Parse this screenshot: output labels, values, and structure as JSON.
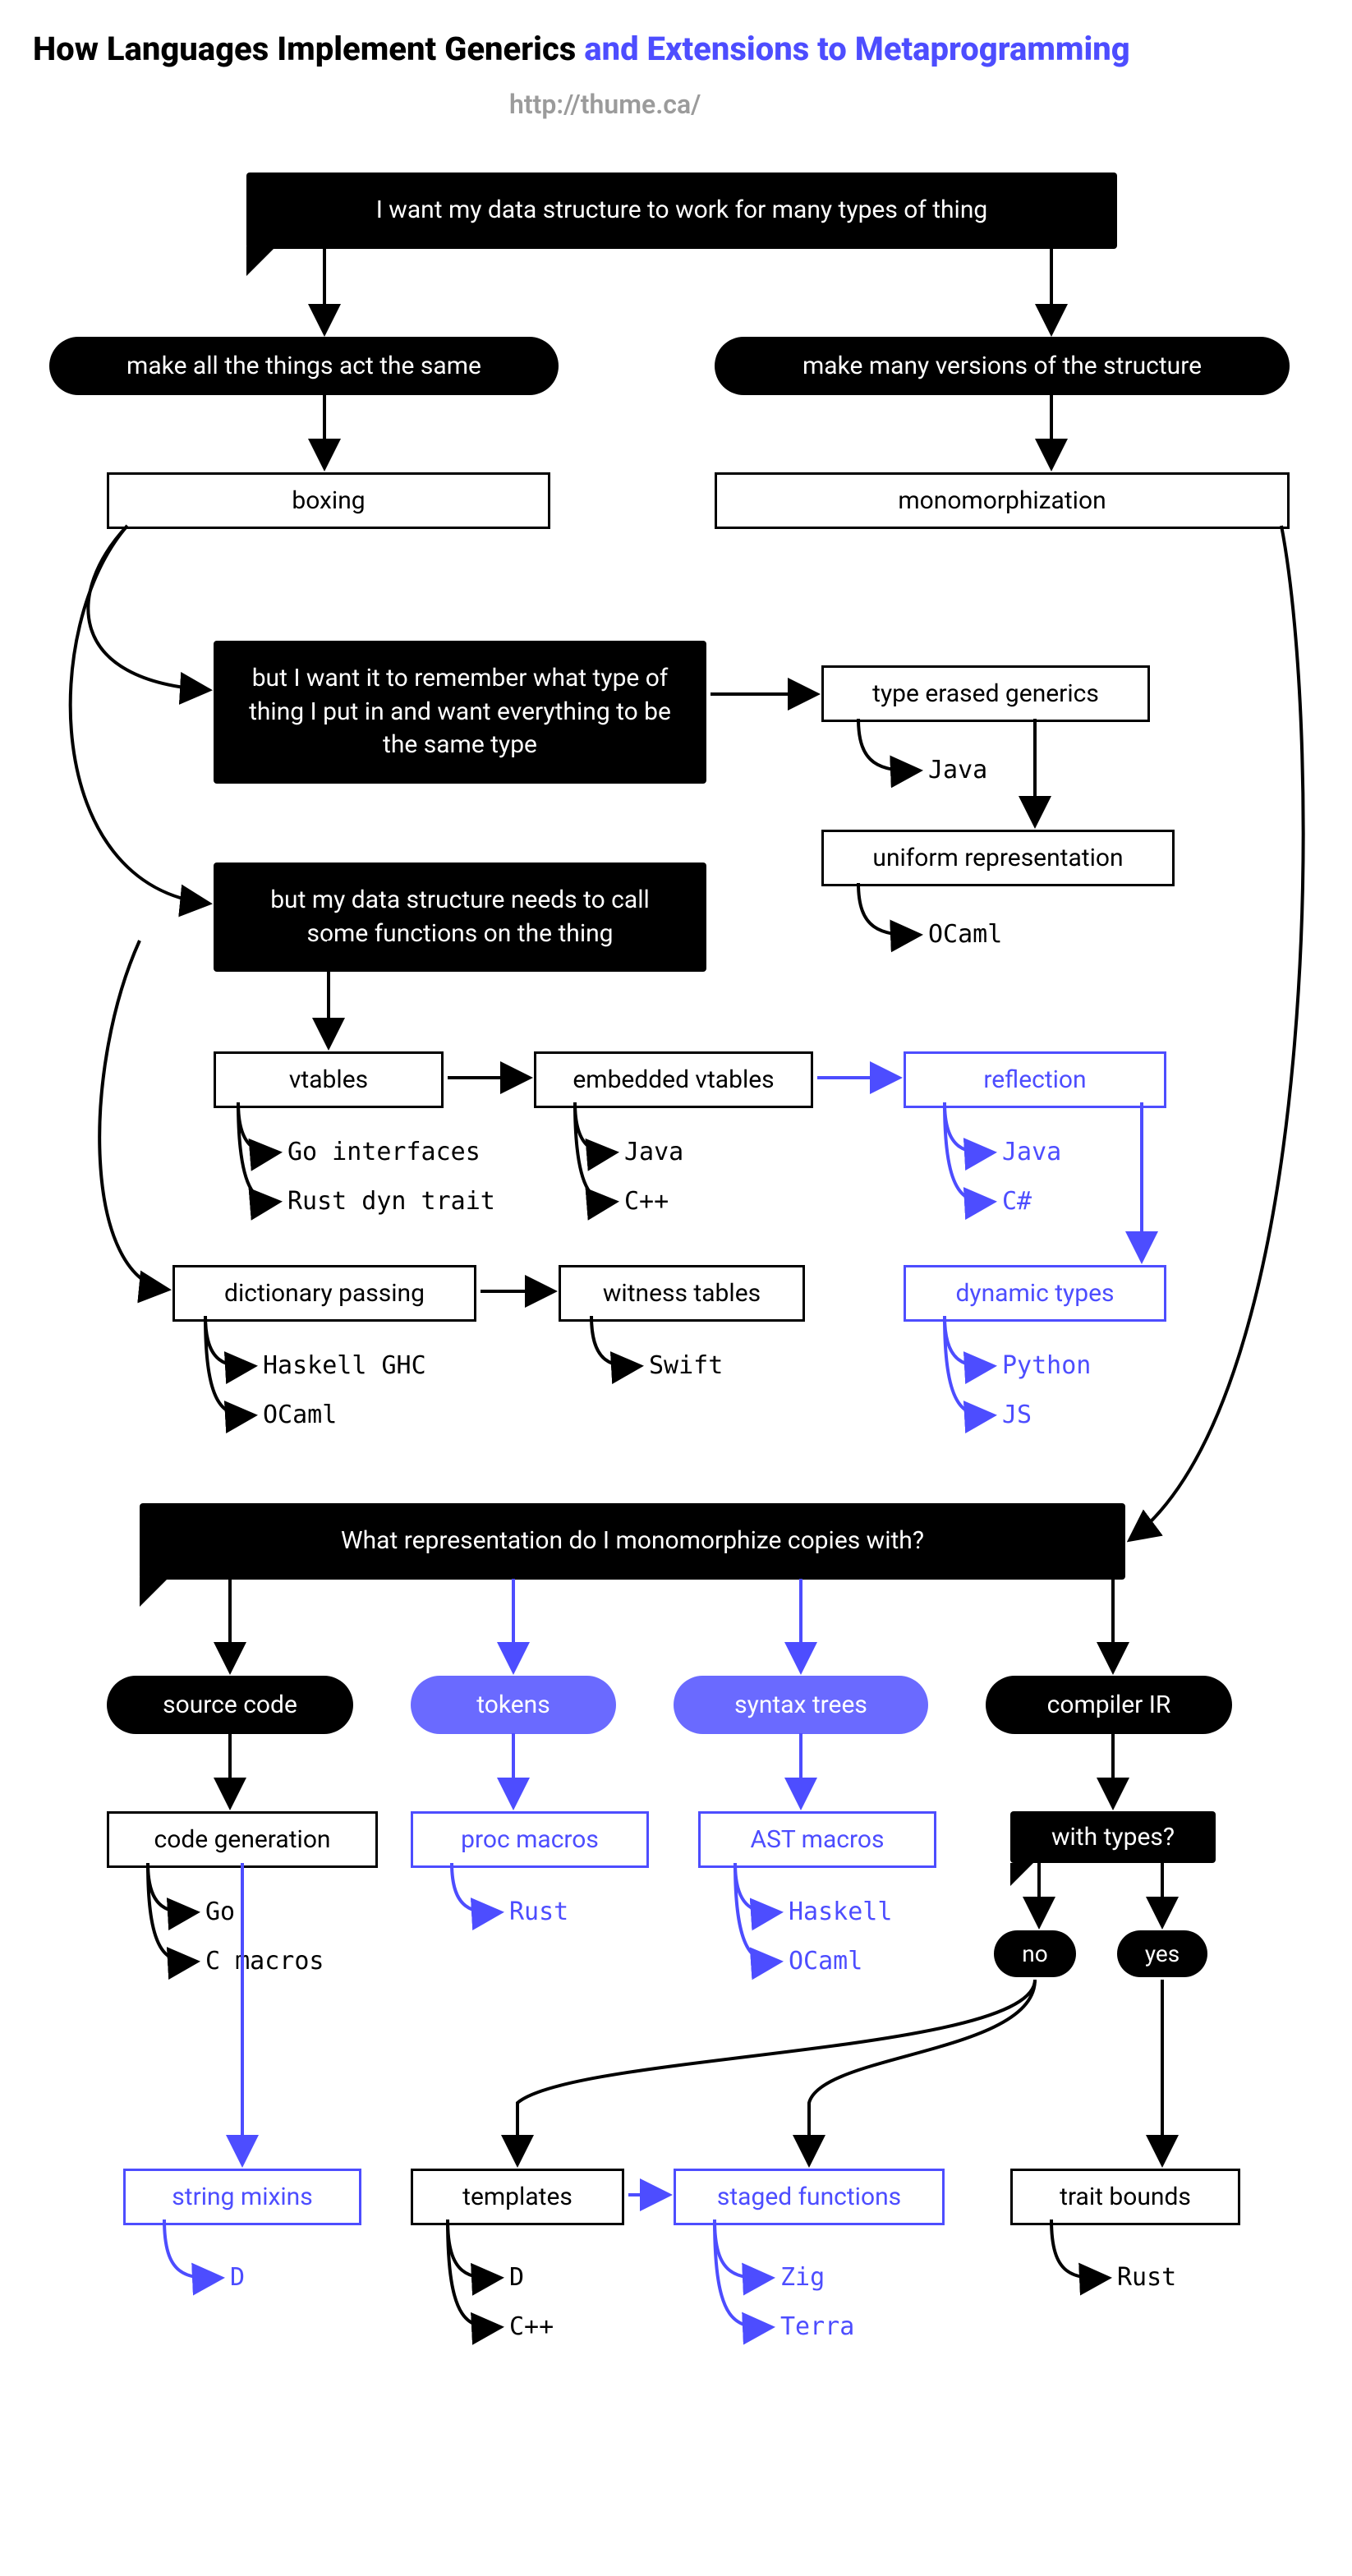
{
  "title_main": "How Languages Implement Generics",
  "title_ext": " and Extensions to Metaprogramming",
  "subtitle": "http://thume.ca/",
  "q_root": "I want my data structure to work for many types of thing",
  "choice_same": "make all the things act the same",
  "choice_many": "make many versions of the structure",
  "box_boxing": "boxing",
  "box_mono": "monomorphization",
  "q_remember": "but I want it to remember what type of thing I put in and want everything to be the same type",
  "box_erased": "type erased generics",
  "lang_java1": "Java",
  "box_uniform": "uniform representation",
  "lang_ocaml1": "OCaml",
  "q_functions": "but my data structure needs to call some functions on the thing",
  "box_vtables": "vtables",
  "box_embvt": "embedded vtables",
  "box_reflection": "reflection",
  "lang_go_if": "Go interfaces",
  "lang_rust_dyn": "Rust dyn trait",
  "lang_java2": "Java",
  "lang_cpp1": "C++",
  "lang_java3": "Java",
  "lang_csharp": "C#",
  "box_dict": "dictionary passing",
  "box_witness": "witness tables",
  "box_dyntypes": "dynamic types",
  "lang_haskell_ghc": "Haskell GHC",
  "lang_ocaml2": "OCaml",
  "lang_swift": "Swift",
  "lang_python": "Python",
  "lang_js": "JS",
  "q_repr": "What representation do I monomorphize copies with?",
  "choice_src": "source code",
  "choice_tokens": "tokens",
  "choice_syntax": "syntax trees",
  "choice_ir": "compiler IR",
  "box_codegen": "code generation",
  "box_proc": "proc macros",
  "box_ast": "AST macros",
  "q_types": "with types?",
  "lang_go2": "Go",
  "lang_cmacros": "C macros",
  "lang_rust1": "Rust",
  "lang_haskell2": "Haskell",
  "lang_ocaml3": "OCaml",
  "ans_no": "no",
  "ans_yes": "yes",
  "box_mixins": "string mixins",
  "box_templates": "templates",
  "box_staged": "staged functions",
  "box_traitbounds": "trait bounds",
  "lang_d1": "D",
  "lang_d2": "D",
  "lang_cpp2": "C++",
  "lang_zig": "Zig",
  "lang_terra": "Terra",
  "lang_rust2": "Rust"
}
